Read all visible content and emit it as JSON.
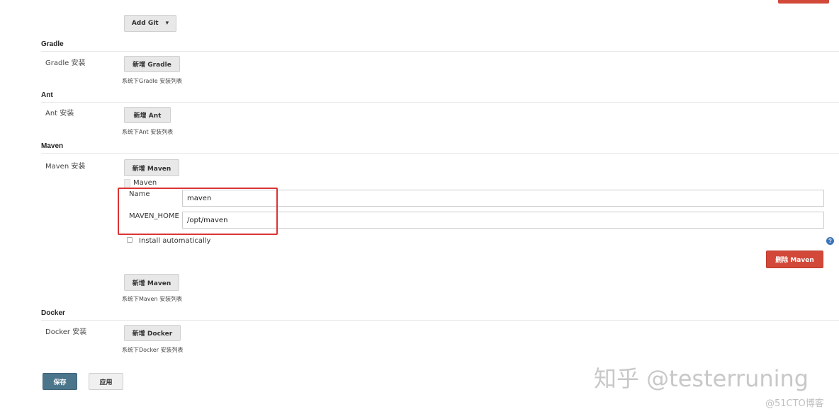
{
  "top_bar": {
    "accent_color": "#d24939"
  },
  "git": {
    "add_git_label": "Add Git",
    "dropdown_arrow": "▾"
  },
  "gradle": {
    "section_title": "Gradle",
    "row_label": "Gradle 安装",
    "add_button": "新增 Gradle",
    "note": "系统下Gradle 安装列表"
  },
  "ant": {
    "section_title": "Ant",
    "row_label": "Ant 安装",
    "add_button": "新增 Ant",
    "note": "系统下Ant 安装列表"
  },
  "maven": {
    "section_title": "Maven",
    "row_label": "Maven 安装",
    "add_button_top": "新增 Maven",
    "entry_header": "Maven",
    "name_label": "Name",
    "name_value": "maven",
    "home_label": "MAVEN_HOME",
    "home_value": "/opt/maven",
    "install_auto_label": "Install automatically",
    "help_icon_text": "?",
    "delete_button": "删除 Maven",
    "add_button_bottom": "新增 Maven",
    "note": "系统下Maven 安装列表"
  },
  "docker": {
    "section_title": "Docker",
    "row_label": "Docker 安装",
    "add_button": "新增 Docker",
    "note": "系统下Docker 安装列表"
  },
  "footer": {
    "save_label": "保存",
    "apply_label": "应用"
  },
  "watermarks": {
    "zhihu": "知乎 @testerruning",
    "blog": "@51CTO博客"
  },
  "colors": {
    "primary": "#4b758b",
    "danger": "#d24939",
    "highlight": "#dd3333"
  }
}
